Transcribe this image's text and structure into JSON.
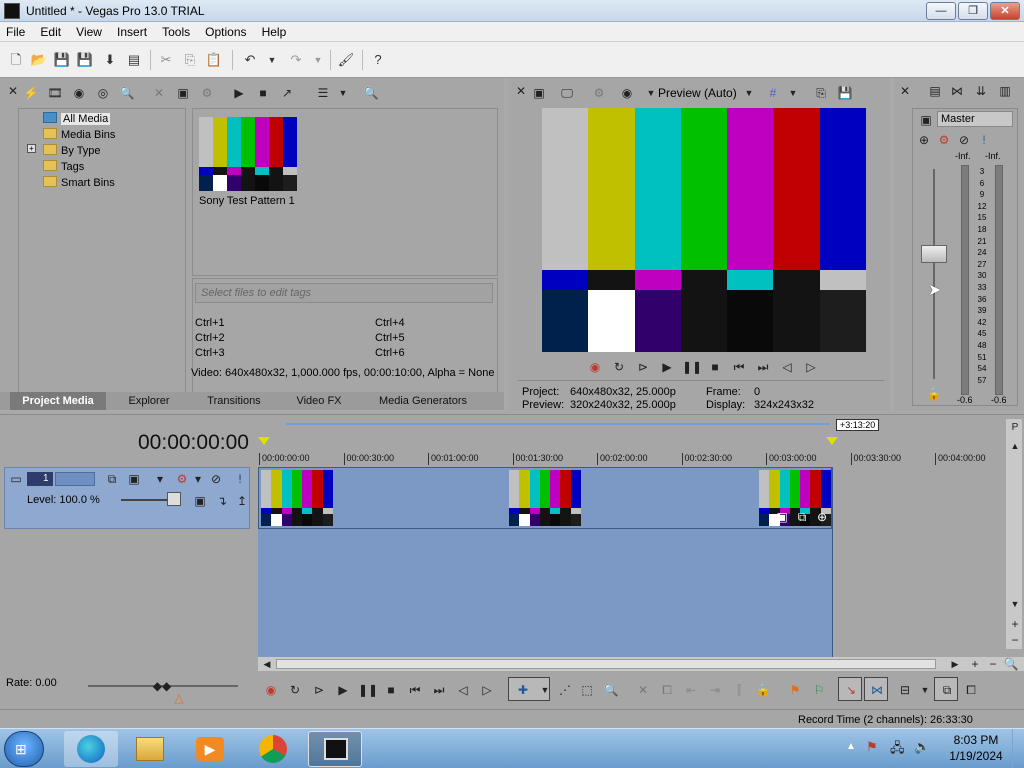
{
  "window": {
    "title": "Untitled * - Vegas Pro 13.0 TRIAL",
    "buttons": {
      "minimize": "—",
      "maximize": "❐",
      "close": "✕"
    }
  },
  "menu": [
    "File",
    "Edit",
    "View",
    "Insert",
    "Tools",
    "Options",
    "Help"
  ],
  "project_media": {
    "tree": [
      "All Media",
      "Media Bins",
      "By Type",
      "Tags",
      "Smart Bins"
    ],
    "expander": "+",
    "thumbnail_label": "Sony Test Pattern 1",
    "tag_placeholder": "Select files to edit tags",
    "shortcuts": [
      "Ctrl+1",
      "Ctrl+2",
      "Ctrl+3",
      "Ctrl+4",
      "Ctrl+5",
      "Ctrl+6"
    ],
    "status": "Video: 640x480x32, 1,000.000 fps, 00:00:10:00, Alpha = None",
    "tabs": [
      "Project Media",
      "Explorer",
      "Transitions",
      "Video FX",
      "Media Generators"
    ]
  },
  "preview": {
    "mode": "Preview (Auto)",
    "project_label": "Project:",
    "project_value": "640x480x32, 25.000p",
    "preview_label": "Preview:",
    "preview_value": "320x240x32, 25.000p",
    "frame_label": "Frame:",
    "frame_value": "0",
    "display_label": "Display:",
    "display_value": "324x243x32"
  },
  "mixer": {
    "master_label": "Master",
    "inf_left": "-Inf.",
    "inf_right": "-Inf.",
    "scale": [
      "3",
      "6",
      "9",
      "12",
      "15",
      "18",
      "21",
      "24",
      "27",
      "30",
      "33",
      "36",
      "39",
      "42",
      "45",
      "48",
      "51",
      "54",
      "57"
    ],
    "bottom_left": "-0.6",
    "bottom_right": "-0.6"
  },
  "timeline": {
    "timecode": "00:00:00:00",
    "cursor_time": "+3:13:20",
    "ruler": [
      "00:00:00:00",
      "00:00:30:00",
      "00:01:00:00",
      "00:01:30:00",
      "00:02:00:00",
      "00:02:30:00",
      "00:03:00:00",
      "00:03:30:00",
      "00:04:00:00"
    ],
    "track": {
      "number": "1",
      "level": "Level: 100.0 %"
    },
    "rate": "Rate: 0.00"
  },
  "status_bar": {
    "record_time": "Record Time (2 channels): 26:33:30"
  },
  "taskbar": {
    "time": "8:03 PM",
    "date": "1/19/2024"
  },
  "colors": {
    "bars_top": [
      "#c0c0c0",
      "#c0c000",
      "#00c0c0",
      "#00c000",
      "#c000c0",
      "#c00000",
      "#0000c0"
    ],
    "bars_mid": [
      "#0000c0",
      "#131313",
      "#c000c0",
      "#131313",
      "#00c0c0",
      "#131313",
      "#c0c0c0"
    ],
    "bars_low": [
      "#00214c",
      "#ffffff",
      "#32006a",
      "#131313",
      "#090909",
      "#131313",
      "#1d1d1d"
    ]
  }
}
